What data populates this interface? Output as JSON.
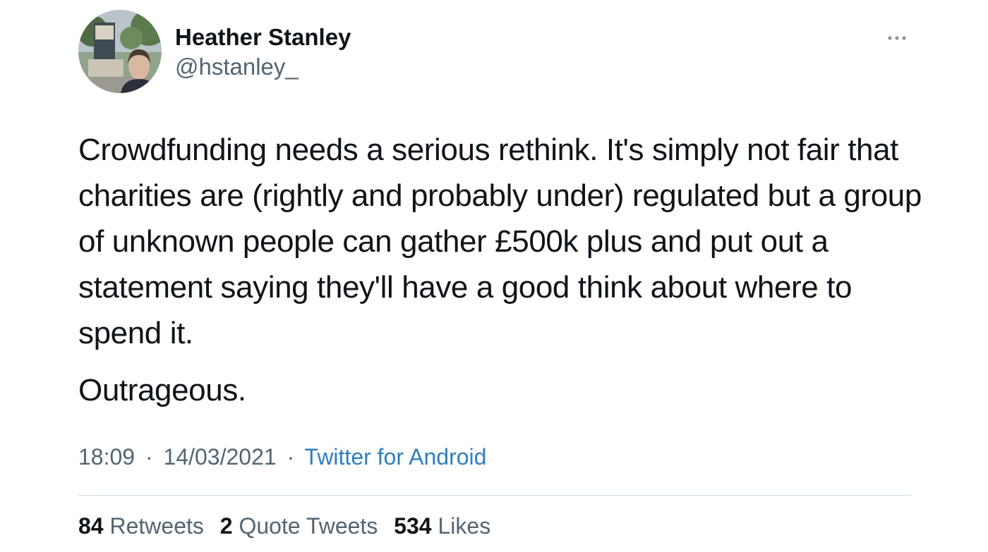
{
  "author": {
    "name": "Heather Stanley",
    "handle": "@hstanley_"
  },
  "tweet": {
    "paragraphs": [
      "Crowdfunding needs a serious rethink. It's simply not fair that charities are (rightly and probably under) regulated but a group of unknown people can gather £500k plus and put out a statement saying they'll have a good think about where to spend it.",
      "Outrageous."
    ]
  },
  "meta": {
    "time": "18:09",
    "date": "14/03/2021",
    "separator": "·",
    "source": "Twitter for Android"
  },
  "stats": {
    "retweets": {
      "count": "84",
      "label": "Retweets"
    },
    "quote_tweets": {
      "count": "2",
      "label": "Quote Tweets"
    },
    "likes": {
      "count": "534",
      "label": "Likes"
    }
  },
  "icons": {
    "more": "more-horizontal-icon"
  },
  "colors": {
    "text": "#0f1419",
    "secondary": "#536471",
    "link": "#2f7fbf",
    "divider": "#cfd9de"
  }
}
